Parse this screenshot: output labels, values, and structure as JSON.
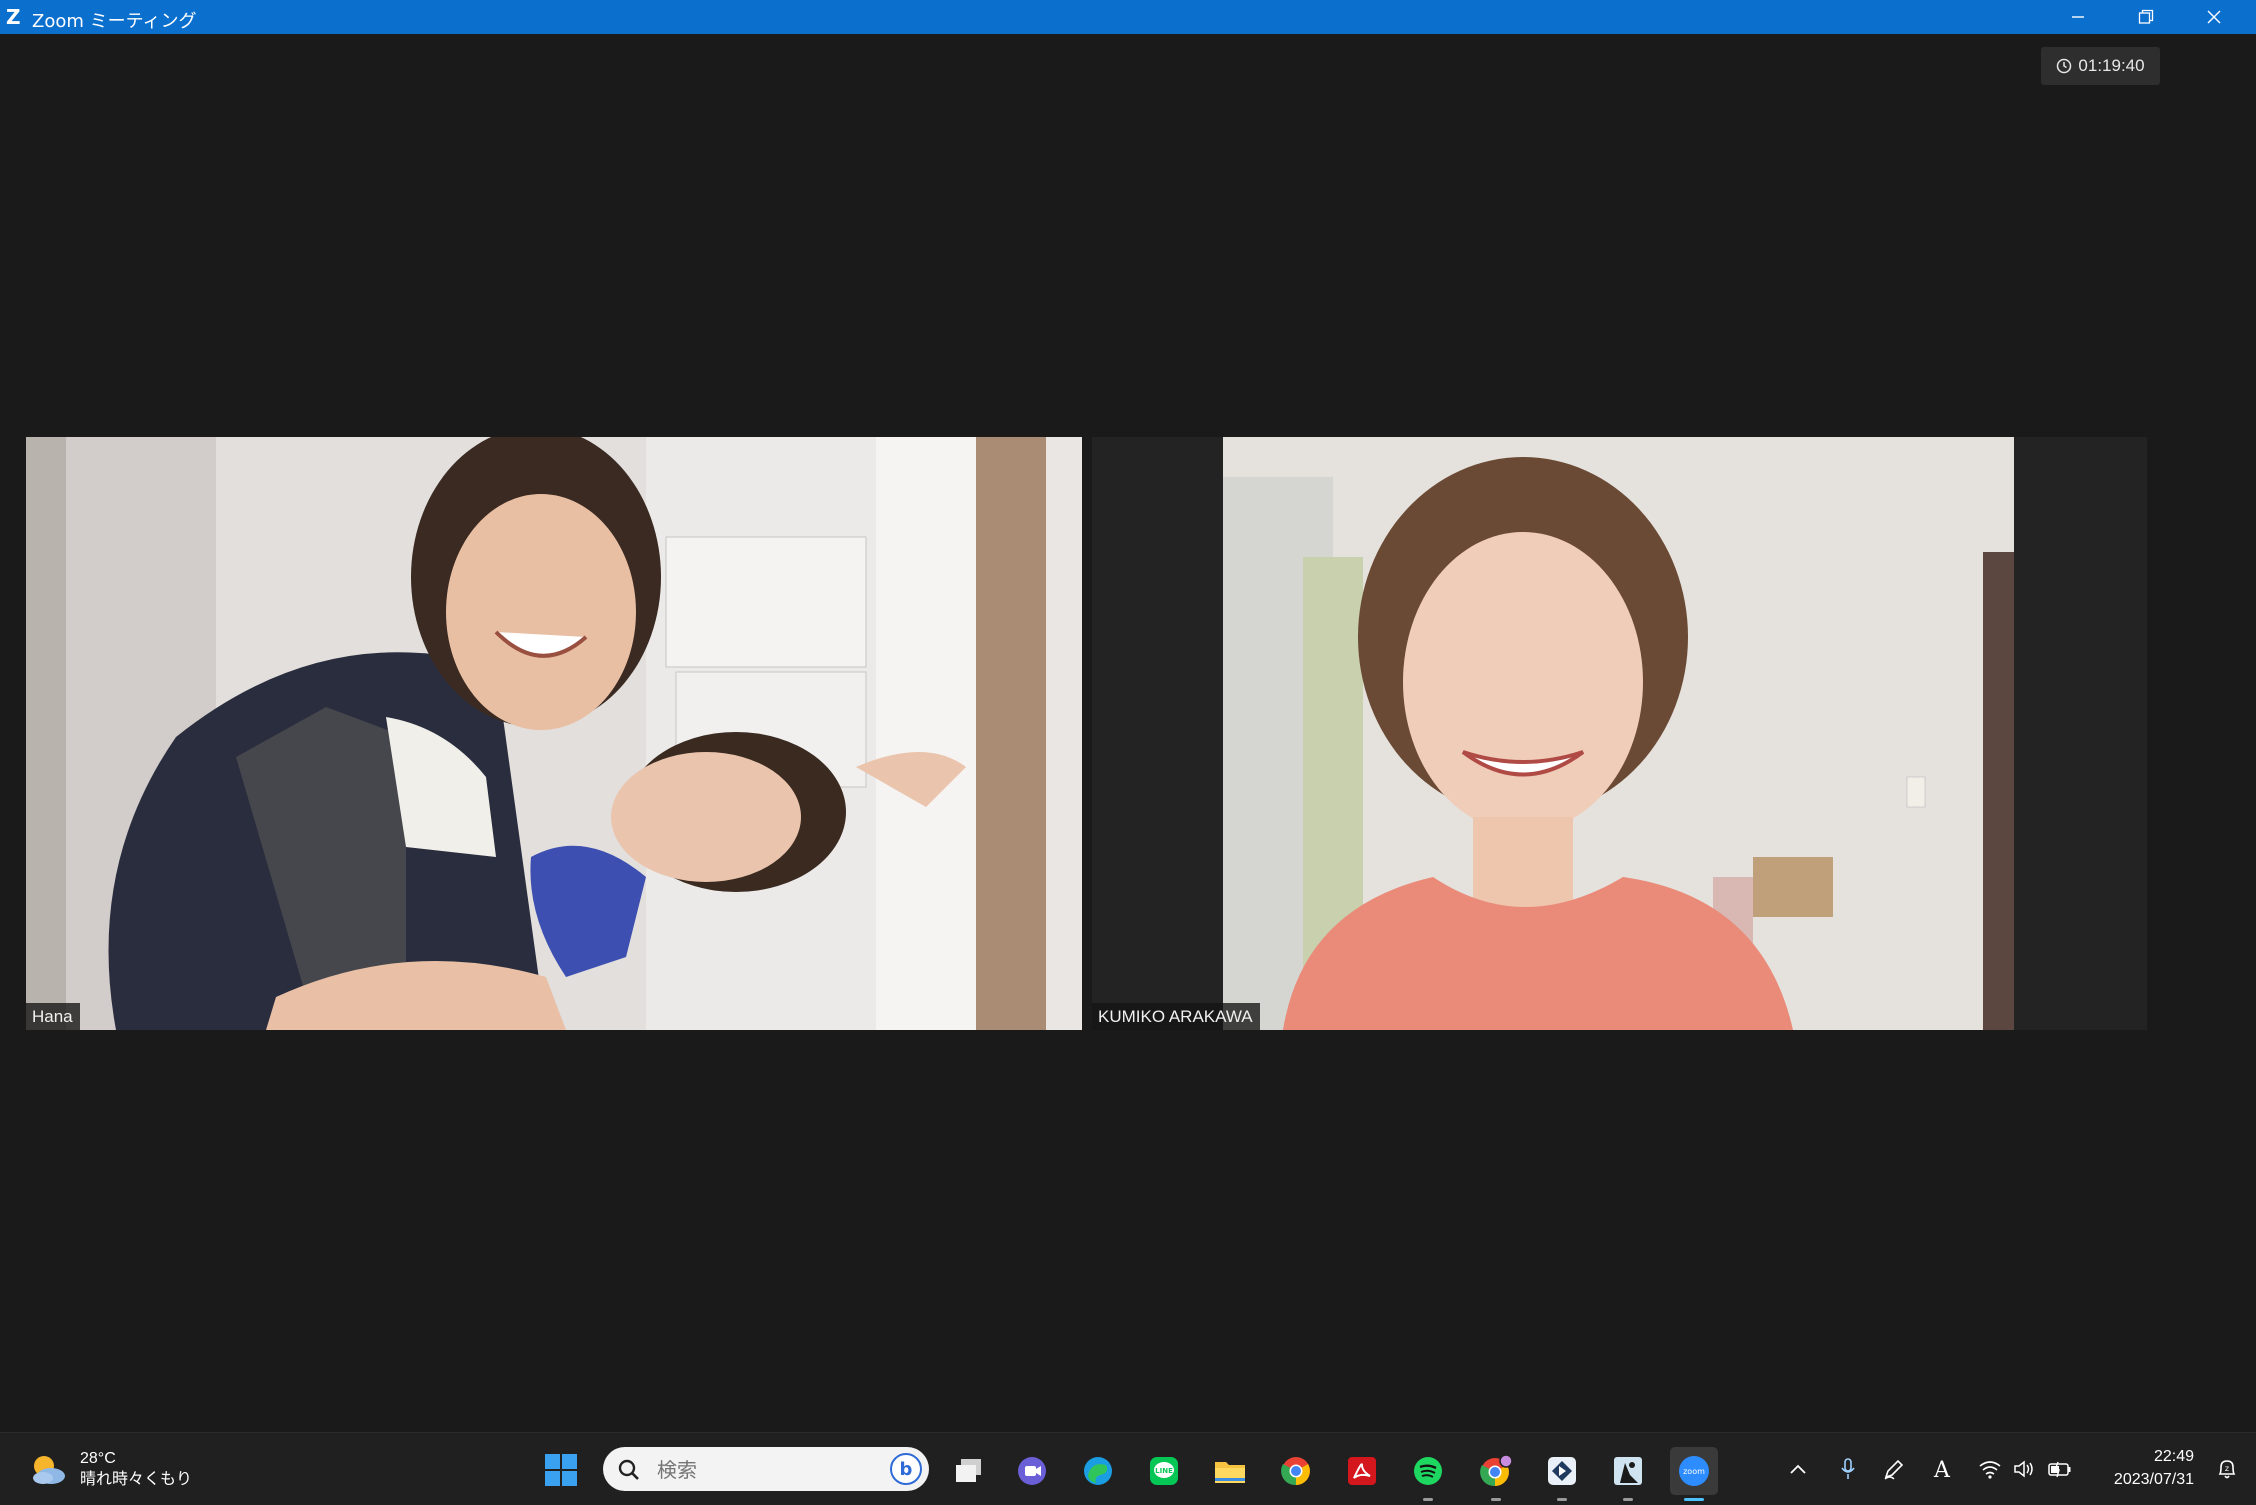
{
  "window": {
    "title": "Zoom ミーティング",
    "controls": [
      "minimize",
      "restore",
      "close"
    ]
  },
  "meeting": {
    "elapsed_time": "01:19:40"
  },
  "participants": [
    {
      "name": "Hana"
    },
    {
      "name": "KUMIKO ARAKAWA"
    }
  ],
  "taskbar": {
    "weather": {
      "temperature": "28°C",
      "condition": "晴れ時々くもり"
    },
    "search": {
      "placeholder": "検索"
    },
    "apps": [
      "start-icon",
      "task-view-icon",
      "teams-chat-icon",
      "edge-icon",
      "line-icon",
      "file-explorer-icon",
      "chrome-icon",
      "acrobat-icon",
      "spotify-icon",
      "chrome-profile-icon",
      "app-dark-icon",
      "app-figure-icon",
      "zoom-icon"
    ],
    "clock": {
      "time": "22:49",
      "date": "2023/07/31"
    }
  },
  "colors": {
    "titlebar": "#0b6fce",
    "background": "#1a1a1a",
    "taskbar": "#202020",
    "accent": "#4cc2ff"
  }
}
